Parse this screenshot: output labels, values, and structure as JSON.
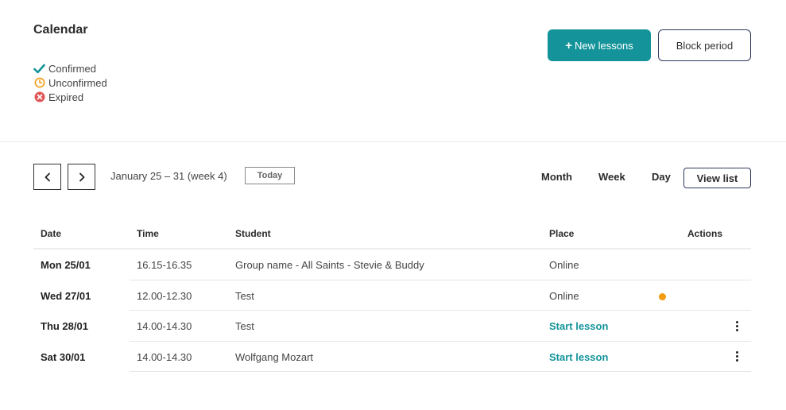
{
  "page": {
    "title": "Calendar"
  },
  "legend": [
    {
      "label": "Confirmed",
      "icon": "check-icon",
      "color": "#14949a"
    },
    {
      "label": "Unconfirmed",
      "icon": "clock-icon",
      "color": "#f39c12"
    },
    {
      "label": "Expired",
      "icon": "x-circle-icon",
      "color": "#e05656"
    }
  ],
  "actions": {
    "new_lessons": "New lessons",
    "block_period": "Block period"
  },
  "navigation": {
    "date_range": "January 25 – 31 (week 4)",
    "today": "Today"
  },
  "views": {
    "month": "Month",
    "week": "Week",
    "day": "Day",
    "list": "View list"
  },
  "table": {
    "headers": {
      "date": "Date",
      "time": "Time",
      "student": "Student",
      "place": "Place",
      "actions": "Actions"
    },
    "rows": [
      {
        "date": "Mon 25/01",
        "time": "16.15-16.35",
        "student": "Group name - All Saints - Stevie & Buddy",
        "place": "Online",
        "status_dot": false,
        "has_menu": false
      },
      {
        "date": "Wed 27/01",
        "time": "12.00-12.30",
        "student": "Test",
        "place": "Online",
        "status_dot": true,
        "has_menu": false
      },
      {
        "date": "Thu 28/01",
        "time": "14.00-14.30",
        "student": "Test",
        "place": "Start lesson",
        "status_dot": false,
        "has_menu": true
      },
      {
        "date": "Sat 30/01",
        "time": "14.00-14.30",
        "student": "Wolfgang Mozart",
        "place": "Start lesson",
        "status_dot": false,
        "has_menu": true
      }
    ]
  },
  "colors": {
    "accent": "#14949a",
    "warning": "#f39c12",
    "danger": "#e05656"
  }
}
